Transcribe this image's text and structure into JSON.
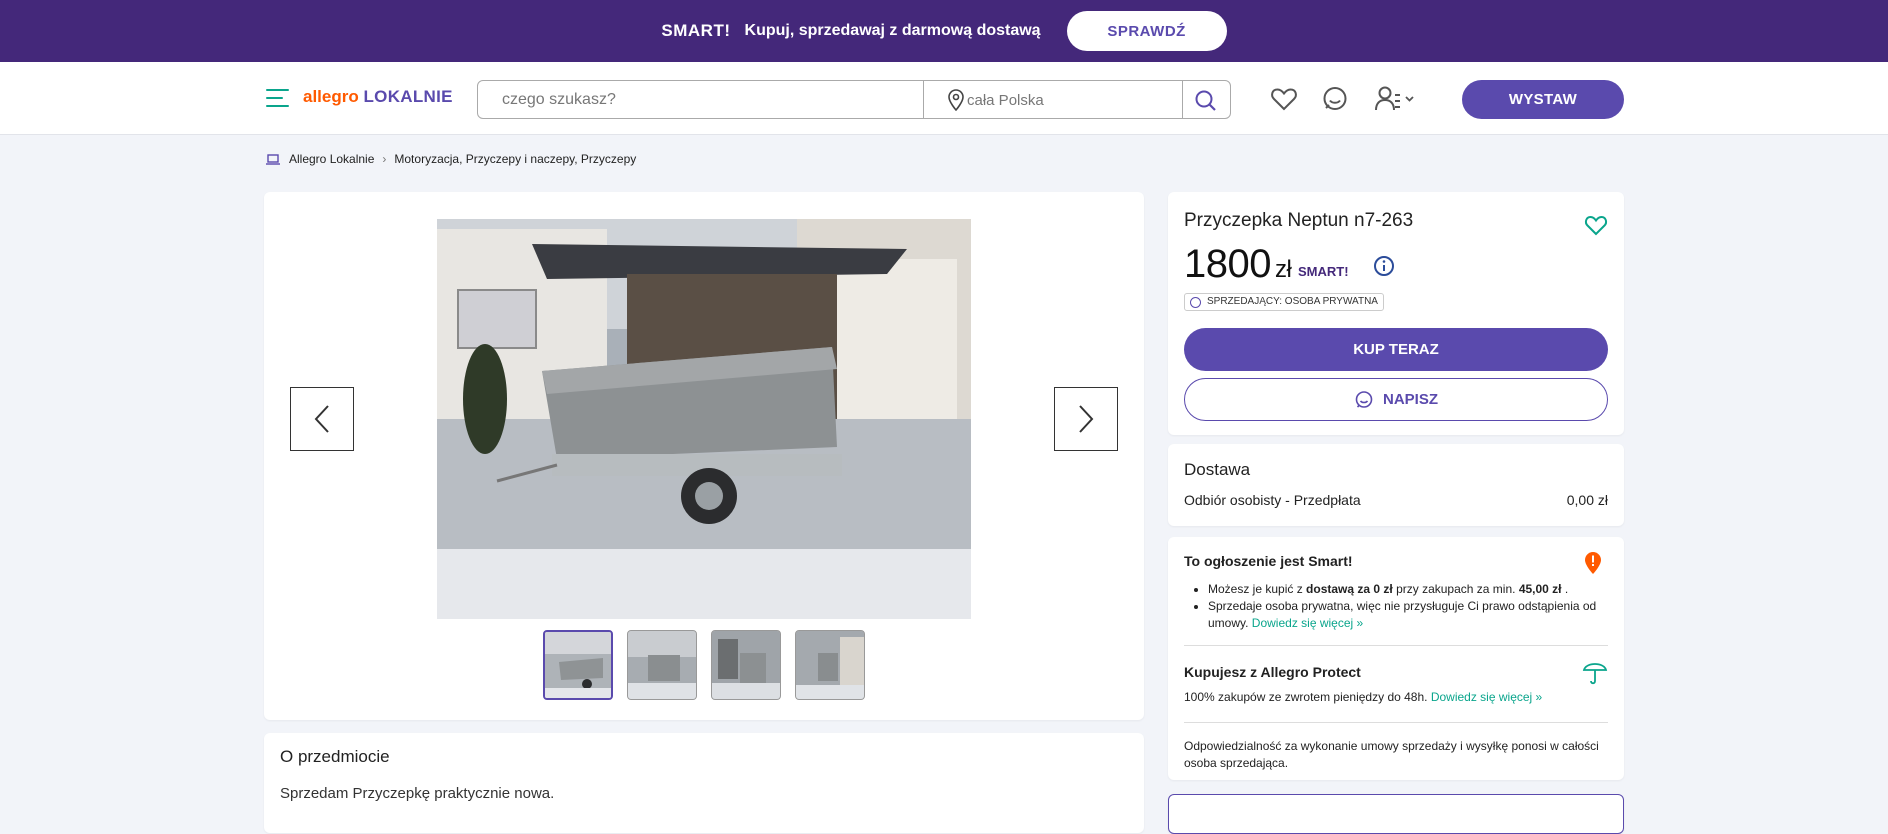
{
  "promo": {
    "brand": "SMART!",
    "message": "Kupuj, sprzedawaj z darmową dostawą",
    "button": "SPRAWDŹ"
  },
  "header": {
    "logo_allegro": "allegro",
    "logo_lokalnie": "LOKALNIE",
    "search_placeholder": "czego szukasz?",
    "location": "cała Polska",
    "wystaw": "WYSTAW"
  },
  "breadcrumb": {
    "home": "Allegro Lokalnie",
    "path": "Motoryzacja, Przyczepy i naczepy, Przyczepy"
  },
  "listing": {
    "title": "Przyczepka Neptun n7-263",
    "price": "1800",
    "currency": "zł",
    "smart_badge": "SMART!",
    "seller_type": "SPRZEDAJĄCY: OSOBA PRYWATNA",
    "buy_now": "KUP TERAZ",
    "message": "NAPISZ",
    "thumbnail_count": 4,
    "selected_thumbnail": 1
  },
  "delivery": {
    "title": "Dostawa",
    "method": "Odbiór osobisty - Przedpłata",
    "cost": "0,00 zł"
  },
  "smart_info": {
    "title": "To ogłoszenie jest Smart!",
    "bullet1_pre": "Możesz je kupić z ",
    "bullet1_bold": "dostawą za 0 zł",
    "bullet1_mid": " przy zakupach za min. ",
    "bullet1_amount": "45,00 zł",
    "bullet1_end": " .",
    "bullet2": "Sprzedaje osoba prywatna, więc nie przysługuje Ci prawo odstąpienia od umowy.",
    "bullet2_link": "Dowiedz się więcej »",
    "protect_title": "Kupujesz z Allegro Protect",
    "protect_text": "100% zakupów ze zwrotem pieniędzy do 48h.",
    "protect_link": "Dowiedz się więcej »",
    "responsibility": "Odpowiedzialność za wykonanie umowy sprzedaży i wysyłkę ponosi w całości osoba sprzedająca."
  },
  "about": {
    "title": "O przedmiocie",
    "text": "Sprzedam Przyczepkę praktycznie nowa."
  },
  "colors": {
    "promo_bg": "#44287a",
    "accent": "#5a4aad",
    "teal": "#0aa58c",
    "orange": "#ff5a00"
  }
}
